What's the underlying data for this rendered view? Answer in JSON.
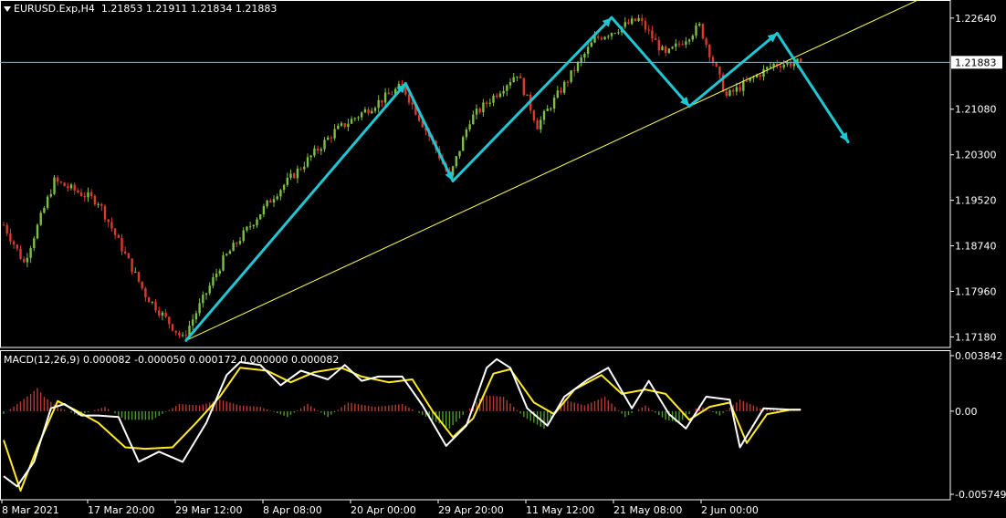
{
  "chart_data": [
    {
      "type": "candlestick",
      "symbol": "EURUSD.Exp",
      "timeframe": "H4",
      "ohlc": {
        "open": "1.21853",
        "high": "1.21911",
        "low": "1.21834",
        "close": "1.21883"
      },
      "current_price": 1.21883,
      "current_price_label": "1.21883",
      "y_range": [
        1.17,
        1.2295
      ],
      "y_ticks": [
        {
          "value": 1.2264,
          "label": "1.22640"
        },
        {
          "value": 1.2108,
          "label": "1.21080"
        },
        {
          "value": 1.203,
          "label": "1.20300"
        },
        {
          "value": 1.1952,
          "label": "1.19520"
        },
        {
          "value": 1.1874,
          "label": "1.18740"
        },
        {
          "value": 1.1796,
          "label": "1.17960"
        },
        {
          "value": 1.1718,
          "label": "1.17180"
        }
      ],
      "x_labels": [
        "8 Mar 2021",
        "17 Mar 20:00",
        "29 Mar 12:00",
        "8 Apr 08:00",
        "20 Apr 00:00",
        "29 Apr 20:00",
        "11 May 12:00",
        "21 May 08:00",
        "2 Jun 00:00"
      ],
      "key_path": [
        {
          "bar": 0,
          "price": 1.191
        },
        {
          "bar": 6,
          "price": 1.1845
        },
        {
          "bar": 15,
          "price": 1.1985
        },
        {
          "bar": 28,
          "price": 1.195
        },
        {
          "bar": 42,
          "price": 1.179
        },
        {
          "bar": 53,
          "price": 1.1715
        },
        {
          "bar": 65,
          "price": 1.185
        },
        {
          "bar": 80,
          "price": 1.196
        },
        {
          "bar": 98,
          "price": 1.207
        },
        {
          "bar": 118,
          "price": 1.2148
        },
        {
          "bar": 128,
          "price": 1.204
        },
        {
          "bar": 132,
          "price": 1.199
        },
        {
          "bar": 138,
          "price": 1.209
        },
        {
          "bar": 152,
          "price": 1.217
        },
        {
          "bar": 158,
          "price": 1.208
        },
        {
          "bar": 166,
          "price": 1.215
        },
        {
          "bar": 175,
          "price": 1.2228
        },
        {
          "bar": 188,
          "price": 1.2262
        },
        {
          "bar": 196,
          "price": 1.22
        },
        {
          "bar": 206,
          "price": 1.225
        },
        {
          "bar": 214,
          "price": 1.213
        },
        {
          "bar": 228,
          "price": 1.2185
        },
        {
          "bar": 236,
          "price": 1.2188
        }
      ],
      "bar_count": 237,
      "trendline": {
        "from": {
          "bar": 54,
          "price": 1.1712
        },
        "to": {
          "bar": 280,
          "price": 1.232
        }
      },
      "projection_arrows": [
        {
          "from": {
            "bar": 54,
            "price": 1.1712
          },
          "to": {
            "bar": 119,
            "price": 1.2152
          }
        },
        {
          "from": {
            "bar": 119,
            "price": 1.2152
          },
          "to": {
            "bar": 133,
            "price": 1.1985
          }
        },
        {
          "from": {
            "bar": 133,
            "price": 1.1985
          },
          "to": {
            "bar": 180,
            "price": 1.2265
          }
        },
        {
          "from": {
            "bar": 180,
            "price": 1.2265
          },
          "to": {
            "bar": 203,
            "price": 1.2113
          }
        },
        {
          "from": {
            "bar": 203,
            "price": 1.2113
          },
          "to": {
            "bar": 229,
            "price": 1.2238
          }
        },
        {
          "from": {
            "bar": 229,
            "price": 1.2238
          },
          "to": {
            "bar": 250,
            "price": 1.2052
          }
        }
      ],
      "colors": {
        "bull": "#7cc043",
        "bear": "#d83a2e",
        "arrow": "#1fc7d4",
        "trendline": "#ffff4d",
        "price_line": "#8fb6c8",
        "grid_frame": "#ffffff"
      }
    },
    {
      "type": "macd",
      "label": "MACD(12,26,9) 0.000082 -0.000050 0.000172 0.000000 0.000082",
      "y_range": [
        -0.005749,
        0.003842
      ],
      "y_ticks": [
        {
          "value": 0.003842,
          "label": "0.003842"
        },
        {
          "value": 0.0,
          "label": "0.00"
        },
        {
          "value": -0.005749,
          "label": "-0.005749"
        }
      ],
      "macd_line": [
        [
          0,
          -0.0045
        ],
        [
          4,
          -0.0052
        ],
        [
          9,
          -0.0035
        ],
        [
          14,
          0.0002
        ],
        [
          18,
          0.0005
        ],
        [
          23,
          -0.0003
        ],
        [
          28,
          -0.0003
        ],
        [
          34,
          -0.0004
        ],
        [
          40,
          -0.0035
        ],
        [
          46,
          -0.0028
        ],
        [
          53,
          -0.0035
        ],
        [
          60,
          -0.0008
        ],
        [
          66,
          0.0025
        ],
        [
          70,
          0.0034
        ],
        [
          76,
          0.0032
        ],
        [
          82,
          0.0018
        ],
        [
          88,
          0.0028
        ],
        [
          96,
          0.0022
        ],
        [
          101,
          0.0032
        ],
        [
          106,
          0.0021
        ],
        [
          111,
          0.0024
        ],
        [
          118,
          0.0024
        ],
        [
          124,
          0.0004
        ],
        [
          131,
          -0.0024
        ],
        [
          137,
          -0.001
        ],
        [
          143,
          0.003
        ],
        [
          146,
          0.0036
        ],
        [
          150,
          0.003
        ],
        [
          155,
          0.0002
        ],
        [
          161,
          -0.001
        ],
        [
          166,
          0.001
        ],
        [
          173,
          0.0022
        ],
        [
          179,
          0.003
        ],
        [
          186,
          0.0002
        ],
        [
          191,
          0.0021
        ],
        [
          197,
          -0.0002
        ],
        [
          202,
          -0.0012
        ],
        [
          208,
          0.001
        ],
        [
          215,
          0.0008
        ],
        [
          218,
          -0.0025
        ],
        [
          225,
          0.0002
        ],
        [
          233,
          0.0001
        ],
        [
          236,
          0.0001
        ]
      ],
      "signal_line": [
        [
          0,
          -0.002
        ],
        [
          5,
          -0.0055
        ],
        [
          10,
          -0.0025
        ],
        [
          16,
          0.0007
        ],
        [
          21,
          0.0001
        ],
        [
          28,
          -0.0008
        ],
        [
          36,
          -0.0025
        ],
        [
          42,
          -0.0026
        ],
        [
          50,
          -0.0025
        ],
        [
          57,
          -0.0008
        ],
        [
          64,
          0.001
        ],
        [
          70,
          0.003
        ],
        [
          78,
          0.0028
        ],
        [
          85,
          0.002
        ],
        [
          92,
          0.0027
        ],
        [
          100,
          0.003
        ],
        [
          106,
          0.0024
        ],
        [
          114,
          0.002
        ],
        [
          121,
          0.0022
        ],
        [
          127,
          0.0
        ],
        [
          133,
          -0.0018
        ],
        [
          139,
          -0.0005
        ],
        [
          145,
          0.0026
        ],
        [
          150,
          0.0029
        ],
        [
          157,
          0.0006
        ],
        [
          163,
          -0.0002
        ],
        [
          169,
          0.0015
        ],
        [
          177,
          0.0025
        ],
        [
          183,
          0.0012
        ],
        [
          190,
          0.0015
        ],
        [
          196,
          0.0012
        ],
        [
          203,
          -0.0006
        ],
        [
          209,
          0.0003
        ],
        [
          215,
          0.0006
        ],
        [
          220,
          -0.0022
        ],
        [
          226,
          -0.0002
        ],
        [
          233,
          0.0001
        ],
        [
          236,
          0.0001
        ]
      ],
      "histogram": [
        [
          0,
          -0.0002
        ],
        [
          8,
          0.0012
        ],
        [
          10,
          0.0016
        ],
        [
          12,
          0.001
        ],
        [
          16,
          0.0003
        ],
        [
          22,
          -0.0003
        ],
        [
          30,
          0.0003
        ],
        [
          36,
          -0.0006
        ],
        [
          44,
          -0.0006
        ],
        [
          52,
          0.0005
        ],
        [
          58,
          0.0004
        ],
        [
          64,
          0.0008
        ],
        [
          70,
          0.0004
        ],
        [
          76,
          0.0003
        ],
        [
          84,
          -0.0004
        ],
        [
          90,
          0.0005
        ],
        [
          96,
          -0.0004
        ],
        [
          102,
          0.0006
        ],
        [
          110,
          0.0003
        ],
        [
          118,
          0.0005
        ],
        [
          126,
          -0.0005
        ],
        [
          132,
          -0.0012
        ],
        [
          138,
          0.0002
        ],
        [
          142,
          0.0011
        ],
        [
          148,
          0.001
        ],
        [
          154,
          -0.0004
        ],
        [
          160,
          -0.0012
        ],
        [
          166,
          0.0008
        ],
        [
          172,
          0.0004
        ],
        [
          178,
          0.001
        ],
        [
          184,
          -0.0004
        ],
        [
          190,
          0.0004
        ],
        [
          196,
          -0.0006
        ],
        [
          200,
          -0.0008
        ],
        [
          206,
          0.0004
        ],
        [
          212,
          -0.0003
        ],
        [
          218,
          0.0008
        ],
        [
          224,
          0.0002
        ],
        [
          230,
          0.0001
        ],
        [
          236,
          0.0
        ]
      ],
      "colors": {
        "macd": "#ffffff",
        "signal": "#ffeb24",
        "hist_pos": "#b93a33",
        "hist_neg": "#4f9a2c"
      }
    }
  ]
}
